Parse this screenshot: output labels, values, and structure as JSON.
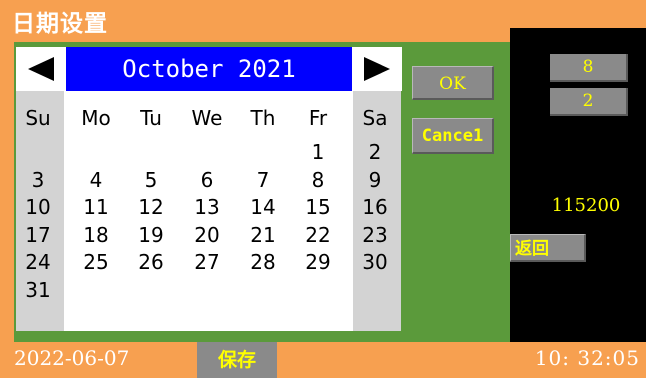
{
  "window": {
    "title": "日期设置"
  },
  "calendar": {
    "month_label": "October 2021",
    "prev_icon": "left-triangle-icon",
    "next_icon": "right-triangle-icon",
    "weekdays": [
      "Su",
      "Mo",
      "Tu",
      "We",
      "Th",
      "Fr",
      "Sa"
    ],
    "weeks": [
      [
        "",
        "",
        "",
        "",
        "",
        "1",
        "2"
      ],
      [
        "3",
        "4",
        "5",
        "6",
        "7",
        "8",
        "9"
      ],
      [
        "10",
        "11",
        "12",
        "13",
        "14",
        "15",
        "16"
      ],
      [
        "17",
        "18",
        "19",
        "20",
        "21",
        "22",
        "23"
      ],
      [
        "24",
        "25",
        "26",
        "27",
        "28",
        "29",
        "30"
      ],
      [
        "31",
        "",
        "",
        "",
        "",
        "",
        ""
      ]
    ]
  },
  "dialog": {
    "ok_label": "OK",
    "cancel_label": "Cance1"
  },
  "panel": {
    "field_1": "8",
    "field_2": "2",
    "field_3": "115200",
    "back_label": "返回"
  },
  "status": {
    "date": "2022-06-07",
    "save_label": "保存",
    "time": "10: 32:05"
  },
  "colors": {
    "orange": "#f7a050",
    "green": "#5b9a3b",
    "header_blue": "#0000ff",
    "button_gray": "#8a8a8a",
    "button_text": "#ffff00"
  }
}
